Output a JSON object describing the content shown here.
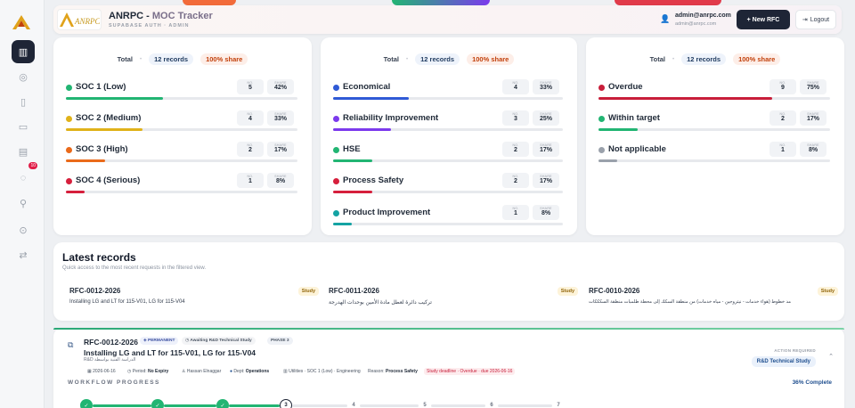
{
  "app": {
    "name": "ANRPC - ",
    "name_highlight": "MOC Tracker",
    "subtitle": "SUPABASE AUTH · ADMIN",
    "logo_text": "ANRPC"
  },
  "user": {
    "email": "admin@anrpc.com",
    "email_small": "admin@anrpc.com"
  },
  "header": {
    "new_label": "+ New RFC",
    "logout_label": "Logout"
  },
  "sidebar": {
    "badge": "10"
  },
  "cards": [
    {
      "total_label": "Total",
      "records": "12 records",
      "share": "100% share",
      "rows": [
        {
          "name": "SOC 1 (Low)",
          "no": "5",
          "share": "42%",
          "color": "#22b573",
          "pct": 42
        },
        {
          "name": "SOC 2 (Medium)",
          "no": "4",
          "share": "33%",
          "color": "#e0b21a",
          "pct": 33
        },
        {
          "name": "SOC 3 (High)",
          "no": "2",
          "share": "17%",
          "color": "#ea6a1a",
          "pct": 17
        },
        {
          "name": "SOC 4 (Serious)",
          "no": "1",
          "share": "8%",
          "color": "#d61f3c",
          "pct": 8
        }
      ]
    },
    {
      "total_label": "Total",
      "records": "12 records",
      "share": "100% share",
      "rows": [
        {
          "name": "Economical",
          "no": "4",
          "share": "33%",
          "color": "#2f5ad6",
          "pct": 33
        },
        {
          "name": "Reliability Improvement",
          "no": "3",
          "share": "25%",
          "color": "#7c3aed",
          "pct": 25
        },
        {
          "name": "HSE",
          "no": "2",
          "share": "17%",
          "color": "#22b573",
          "pct": 17
        },
        {
          "name": "Process Safety",
          "no": "2",
          "share": "17%",
          "color": "#d61f3c",
          "pct": 17
        },
        {
          "name": "Product Improvement",
          "no": "1",
          "share": "8%",
          "color": "#14a3a3",
          "pct": 8
        }
      ]
    },
    {
      "total_label": "Total",
      "records": "12 records",
      "share": "100% share",
      "rows": [
        {
          "name": "Overdue",
          "no": "9",
          "share": "75%",
          "color": "#c81e3a",
          "pct": 75
        },
        {
          "name": "Within target",
          "no": "2",
          "share": "17%",
          "color": "#22b573",
          "pct": 17
        },
        {
          "name": "Not applicable",
          "no": "1",
          "share": "8%",
          "color": "#9aa1ab",
          "pct": 8
        }
      ]
    }
  ],
  "stat_labels": {
    "no": "NO.",
    "share": "SHARE"
  },
  "latest": {
    "title": "Latest records",
    "subtitle": "Quick access to the most recent requests in the filtered view.",
    "items": [
      {
        "id": "RFC-0012-2026",
        "desc": "Installing LG and LT for 115-V01, LG for 115-V04",
        "tag": "Study"
      },
      {
        "id": "RFC-0011-2026",
        "desc": "تركيب دائرة لعطل مادة الأمين بوحدات الهدرجة",
        "tag": "Study"
      },
      {
        "id": "RFC-0010-2026",
        "desc": "مد خطوط (هواء خدمات - نيتروجين - مياه خدمات) من منطقة السكك إلى محطة طلمبات منطقة السكككات",
        "tag": "Study"
      }
    ]
  },
  "detail": {
    "id": "RFC-0012-2026",
    "permanent": "PERMANENT",
    "status": "Awaiting R&D Technical Study",
    "phase": "PHASE 3",
    "title": "Installing LG and LT for 115-V01, LG for 115-V04",
    "title_ar": "R&D الدراسة الفنية بواسطة",
    "date": "2026-06-16",
    "period_label": "Period:",
    "period": "No Expiry",
    "person": "Hassan Elnaggar",
    "dept_label": "Dept:",
    "dept": "Operations",
    "unit": "Utilities · SOC 1 (Low) · Engineering",
    "reason_label": "Reason:",
    "reason": "Process Safety",
    "deadline": "Study deadline · Overdue · due 2026-06-16",
    "action_label": "ACTION REQUIRED",
    "action": "R&D Technical Study",
    "workflow_label": "WORKFLOW PROGRESS",
    "complete": "36% Complete",
    "steps": [
      "✓",
      "✓",
      "✓",
      "3",
      "4",
      "5",
      "6",
      "7"
    ]
  }
}
